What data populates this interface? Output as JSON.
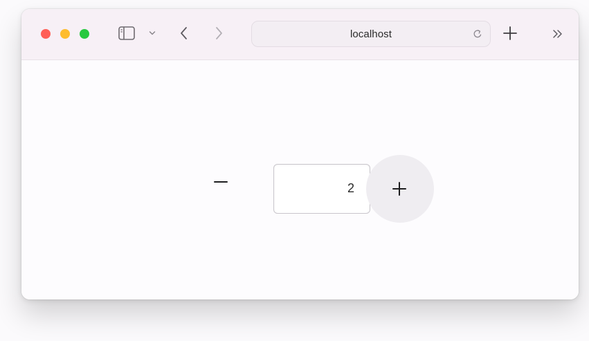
{
  "browser": {
    "address": "localhost",
    "icons": {
      "sidebar": "sidebar-icon",
      "sidebar_menu": "chevron-down-icon",
      "back": "chevron-left-icon",
      "forward": "chevron-right-icon",
      "reload": "reload-icon",
      "new_tab": "plus-icon",
      "overflow": "double-chevron-right-icon"
    },
    "traffic_lights": {
      "close": "#ff5f57",
      "minimize": "#febc2e",
      "maximize": "#28c840"
    }
  },
  "stepper": {
    "value": "2",
    "decrement_icon": "minus-icon",
    "increment_icon": "plus-icon",
    "increment_hover_color": "#efedf1"
  }
}
